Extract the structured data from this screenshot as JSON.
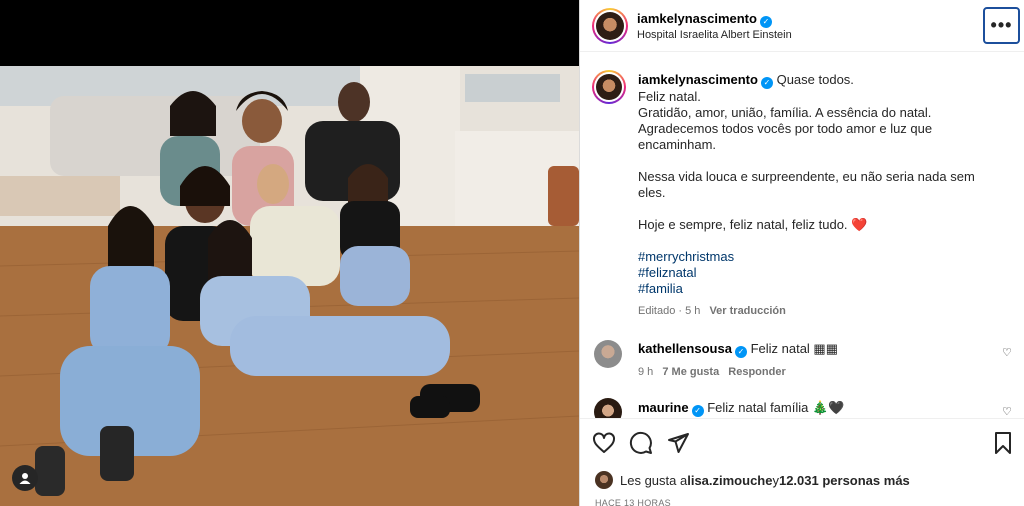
{
  "post": {
    "author": "iamkelynascimento",
    "location": "Hospital Israelita Albert Einstein",
    "more_label": "•••"
  },
  "caption": {
    "author": "iamkelynascimento",
    "lines": [
      "Quase todos.",
      "Feliz natal.",
      "Gratidão, amor, união, família. A essência do natal.",
      "Agradecemos todos vocês por todo amor e luz que",
      "encaminham.",
      "",
      "Nessa vida louca e surpreendente, eu não seria nada sem",
      "eles.",
      "",
      "Hoje e sempre, feliz natal, feliz tudo. ❤️"
    ],
    "hashtags": [
      "#merrychristmas",
      "#feliznatal",
      "#familia"
    ],
    "edited": "Editado · 5 h",
    "translate": "Ver traducción"
  },
  "comments": [
    {
      "user": "kathellensousa",
      "text": "Feliz natal ▦▦",
      "time": "9 h",
      "likes": "7 Me gusta",
      "reply": "Responder"
    },
    {
      "user": "maurine",
      "text": "Feliz natal família 🎄🖤"
    }
  ],
  "footer": {
    "likes_prefix": "Les gusta a ",
    "likes_user": "lisa.zimouche",
    "likes_and": " y ",
    "likes_count": "12.031 personas más",
    "time_ago": "HACE 13 HORAS"
  },
  "icons": {
    "verified": "verified-badge",
    "like": "heart-outline",
    "comment": "speech-bubble",
    "share": "paper-plane",
    "save": "bookmark",
    "tag": "person-tag"
  },
  "colors": {
    "link": "#00376b",
    "verified": "#0095f6",
    "muted": "#737373"
  }
}
